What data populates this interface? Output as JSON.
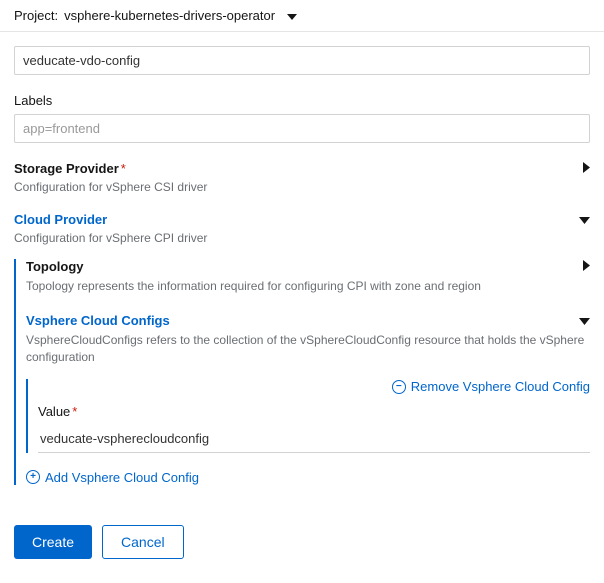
{
  "header": {
    "label": "Project:",
    "project_name": "vsphere-kubernetes-drivers-operator"
  },
  "name_field": {
    "value": "veducate-vdo-config"
  },
  "labels_field": {
    "label": "Labels",
    "placeholder": "app=frontend"
  },
  "storage_provider": {
    "title": "Storage Provider",
    "required_marker": "*",
    "desc": "Configuration for vSphere CSI driver"
  },
  "cloud_provider": {
    "title": "Cloud Provider",
    "desc": "Configuration for vSphere CPI driver",
    "topology": {
      "title": "Topology",
      "desc": "Topology represents the information required for configuring CPI with zone and region"
    },
    "vsphere_cloud_configs": {
      "title": "Vsphere Cloud Configs",
      "desc": "VsphereCloudConfigs refers to the collection of the vSphereCloudConfig resource that holds the vSphere configuration",
      "remove_label": "Remove Vsphere Cloud Config",
      "value_label": "Value",
      "value_required_marker": "*",
      "value": "veducate-vspherecloudconfig",
      "add_label": "Add Vsphere Cloud Config"
    }
  },
  "footer": {
    "create": "Create",
    "cancel": "Cancel"
  }
}
